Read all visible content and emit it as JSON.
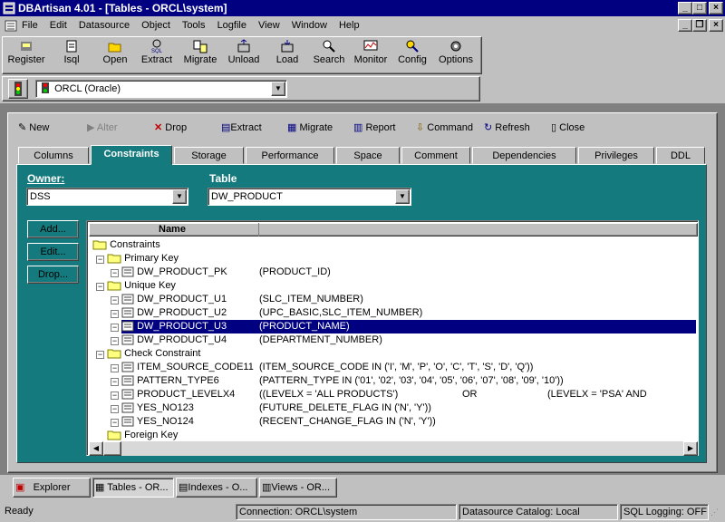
{
  "window": {
    "title": "DBArtisan 4.01 - [Tables - ORCL\\system]"
  },
  "menu": [
    "File",
    "Edit",
    "Datasource",
    "Object",
    "Tools",
    "Logfile",
    "View",
    "Window",
    "Help"
  ],
  "toolbar": [
    {
      "label": "Register",
      "icon": "register-icon"
    },
    {
      "label": "Isql",
      "icon": "isql-icon"
    },
    {
      "label": "Open",
      "icon": "open-icon"
    },
    {
      "label": "Extract",
      "icon": "sql-extract-icon"
    },
    {
      "label": "Migrate",
      "icon": "migrate-icon"
    },
    {
      "label": "Unload",
      "icon": "unload-icon"
    },
    {
      "label": "Load",
      "icon": "load-icon"
    },
    {
      "label": "Search",
      "icon": "search-icon"
    },
    {
      "label": "Monitor",
      "icon": "monitor-icon"
    },
    {
      "label": "Config",
      "icon": "config-icon"
    },
    {
      "label": "Options",
      "icon": "options-icon"
    }
  ],
  "datasource": {
    "selected": "ORCL (Oracle)"
  },
  "child_toolbar": [
    "New",
    "Alter",
    "Drop",
    "Extract",
    "Migrate",
    "Report",
    "Command",
    "Refresh",
    "Close"
  ],
  "tabs": [
    "Columns",
    "Constraints",
    "Storage",
    "Performance",
    "Space",
    "Comment",
    "Dependencies",
    "Privileges",
    "DDL"
  ],
  "owner": {
    "label": "Owner:",
    "value": "DSS"
  },
  "table": {
    "label": "Table",
    "value": "DW_PRODUCT"
  },
  "side_buttons": [
    "Add...",
    "Edit...",
    "Drop..."
  ],
  "tree": {
    "header": "Name",
    "root": "Constraints",
    "groups": [
      {
        "name": "Primary Key",
        "items": [
          {
            "name": "DW_PRODUCT_PK",
            "def": "(PRODUCT_ID)"
          }
        ]
      },
      {
        "name": "Unique Key",
        "items": [
          {
            "name": "DW_PRODUCT_U1",
            "def": "(SLC_ITEM_NUMBER)"
          },
          {
            "name": "DW_PRODUCT_U2",
            "def": "(UPC_BASIC,SLC_ITEM_NUMBER)"
          },
          {
            "name": "DW_PRODUCT_U3",
            "def": "(PRODUCT_NAME)"
          },
          {
            "name": "DW_PRODUCT_U4",
            "def": "(DEPARTMENT_NUMBER)"
          }
        ]
      },
      {
        "name": "Check Constraint",
        "items": [
          {
            "name": "ITEM_SOURCE_CODE11",
            "def": "(ITEM_SOURCE_CODE IN ('I', 'M', 'P', 'O', 'C', 'T', 'S', 'D', 'Q'))"
          },
          {
            "name": "PATTERN_TYPE6",
            "def": "(PATTERN_TYPE IN ('01', '02', '03', '04', '05', '06', '07', '08', '09', '10'))"
          },
          {
            "name": "PRODUCT_LEVELX4",
            "def": "((LEVELX = 'ALL PRODUCTS')",
            "def2": "OR",
            "def3": "(LEVELX = 'PSA' AND"
          },
          {
            "name": "YES_NO123",
            "def": "(FUTURE_DELETE_FLAG IN ('N', 'Y'))"
          },
          {
            "name": "YES_NO124",
            "def": "(RECENT_CHANGE_FLAG IN ('N', 'Y'))"
          }
        ]
      },
      {
        "name": "Foreign Key",
        "items": []
      }
    ],
    "selected": "DW_PRODUCT_U3"
  },
  "window_tabs": [
    "Explorer",
    "Tables - OR...",
    "Indexes - O...",
    "Views - OR..."
  ],
  "status": {
    "ready": "Ready",
    "connection": "Connection: ORCL\\system",
    "catalog": "Datasource Catalog: Local",
    "logging": "SQL Logging: OFF"
  },
  "colors": {
    "titlebar": "#000080",
    "panel": "#157a7e",
    "selection": "#000080"
  }
}
